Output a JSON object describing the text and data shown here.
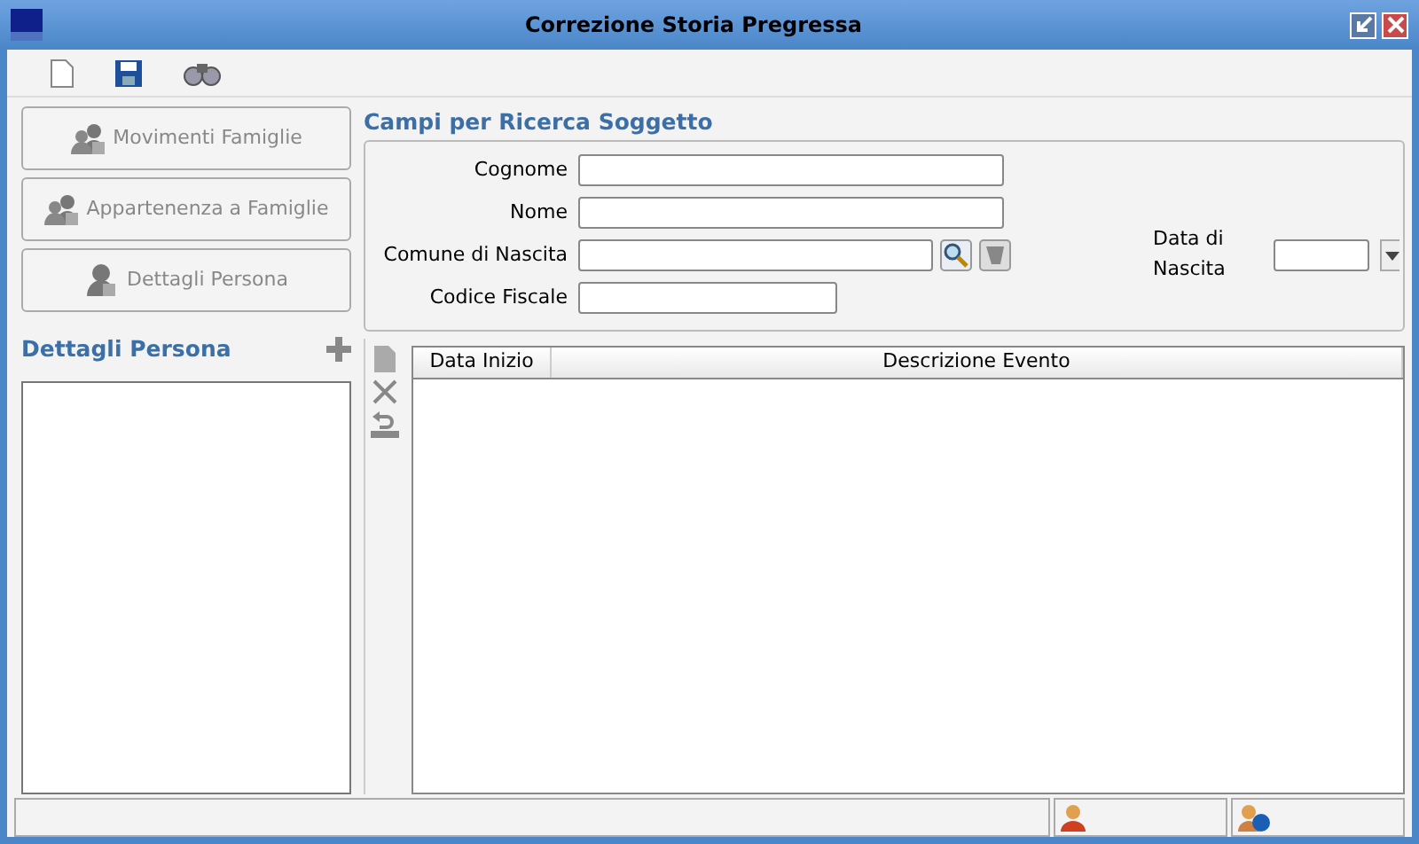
{
  "window": {
    "title": "Correzione Storia Pregressa"
  },
  "nav_buttons": [
    {
      "label": "Movimenti Famiglie",
      "disabled": true,
      "kind": "family"
    },
    {
      "label": "Appartenenza a Famiglie",
      "disabled": true,
      "kind": "family"
    },
    {
      "label": "Dettagli Persona",
      "disabled": true,
      "kind": "person"
    }
  ],
  "details_panel": {
    "title": "Dettagli Persona"
  },
  "search": {
    "title": "Campi per Ricerca Soggetto",
    "fields": [
      {
        "label": "Cognome",
        "kind": "text"
      },
      {
        "label": "Nome",
        "kind": "text"
      },
      {
        "label": "Comune di Nascita",
        "kind": "lookup"
      },
      {
        "label": "Codice Fiscale",
        "kind": "short"
      }
    ],
    "date_field": {
      "label": "Data di Nascita"
    }
  },
  "table": {
    "columns": [
      "Data Inizio",
      "Descrizione Evento"
    ]
  }
}
